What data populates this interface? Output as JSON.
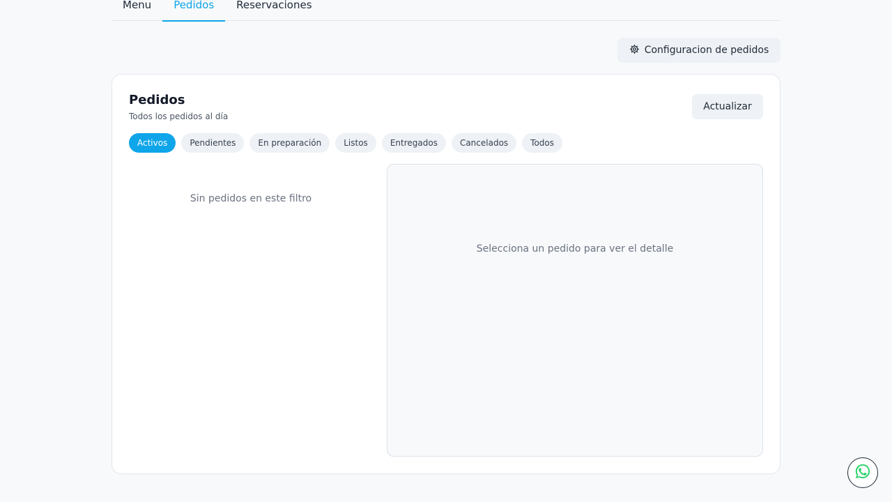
{
  "nav": {
    "tabs": [
      {
        "label": "Menu",
        "active": false
      },
      {
        "label": "Pedidos",
        "active": true
      },
      {
        "label": "Reservaciones",
        "active": false
      }
    ]
  },
  "toolbar": {
    "config_label": "Configuracion de pedidos",
    "config_icon": "gear-icon"
  },
  "orders": {
    "title": "Pedidos",
    "subtitle": "Todos los pedidos al día",
    "refresh_label": "Actualizar",
    "filters": [
      {
        "label": "Activos",
        "active": true
      },
      {
        "label": "Pendientes",
        "active": false
      },
      {
        "label": "En preparación",
        "active": false
      },
      {
        "label": "Listos",
        "active": false
      },
      {
        "label": "Entregados",
        "active": false
      },
      {
        "label": "Cancelados",
        "active": false
      },
      {
        "label": "Todos",
        "active": false
      }
    ],
    "empty_list_text": "Sin pedidos en este filtro",
    "detail_placeholder": "Selecciona un pedido para ver el detalle"
  },
  "floating": {
    "whatsapp_icon": "whatsapp-icon"
  },
  "colors": {
    "accent": "#0ea5e9",
    "background": "#f7f9fb",
    "whatsapp": "#25d366"
  }
}
